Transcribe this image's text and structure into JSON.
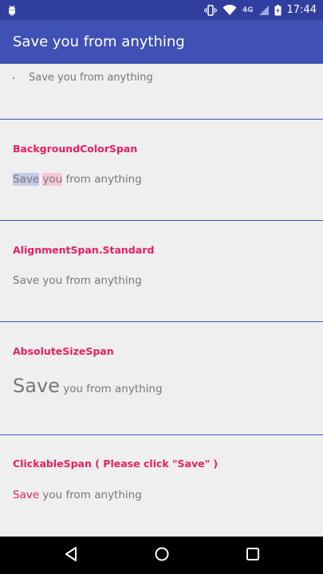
{
  "status_bar": {
    "network_label": "4G",
    "time": "17:44"
  },
  "app_bar": {
    "title": "Save you from anything"
  },
  "list_item": {
    "text": "Save you from anything"
  },
  "sections": {
    "background": {
      "title": "BackgroundColorSpan",
      "save": "Save",
      "you": "you",
      "rest": " from anything"
    },
    "alignment": {
      "title": "AlignmentSpan.Standard",
      "text": "Save you from anything"
    },
    "absolute": {
      "title": "AbsoluteSizeSpan",
      "save": "Save",
      "rest": " you from anything"
    },
    "clickable": {
      "title": "ClickableSpan ( Please click \"Save\" )",
      "save": "Save",
      "rest": " you from anything"
    }
  },
  "colors": {
    "status_bar": "#303f9f",
    "app_bar": "#3f51b5",
    "accent": "#e91e63",
    "divider": "#3f51b5",
    "background": "#efefef"
  },
  "icons": [
    "android-icon",
    "vibrate-icon",
    "wifi-icon",
    "battery-icon",
    "back-icon",
    "home-icon",
    "recents-icon"
  ]
}
